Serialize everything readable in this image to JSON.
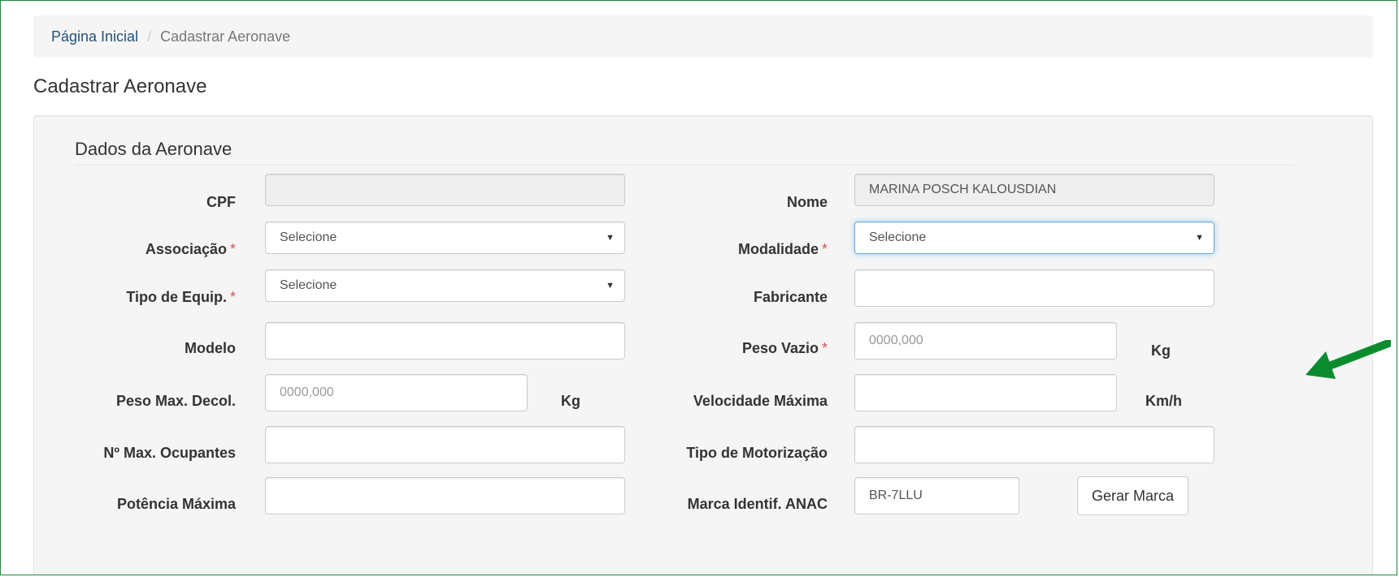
{
  "breadcrumb": {
    "home": "Página Inicial",
    "separator": "/",
    "current": "Cadastrar Aeronave"
  },
  "page_title": "Cadastrar Aeronave",
  "section_title": "Dados da Aeronave",
  "fields": {
    "cpf": {
      "label": "CPF",
      "value": ""
    },
    "nome": {
      "label": "Nome",
      "value": "MARINA POSCH KALOUSDIAN"
    },
    "associacao": {
      "label": "Associação",
      "value": "Selecione",
      "required_mark": "*"
    },
    "modalidade": {
      "label": "Modalidade",
      "value": "Selecione",
      "required_mark": "*"
    },
    "tipo_equip": {
      "label": "Tipo de Equip.",
      "value": "Selecione",
      "required_mark": "*"
    },
    "fabricante": {
      "label": "Fabricante",
      "value": ""
    },
    "modelo": {
      "label": "Modelo",
      "value": ""
    },
    "peso_vazio": {
      "label": "Peso Vazio",
      "placeholder": "0000,000",
      "unit": "Kg",
      "required_mark": "*"
    },
    "peso_max_decol": {
      "label": "Peso Max. Decol.",
      "placeholder": "0000,000",
      "unit": "Kg"
    },
    "velocidade_maxima": {
      "label": "Velocidade Máxima",
      "value": "",
      "unit": "Km/h"
    },
    "max_ocupantes": {
      "label": "Nº Max. Ocupantes",
      "value": ""
    },
    "tipo_motorizacao": {
      "label": "Tipo de Motorização",
      "value": ""
    },
    "potencia_maxima": {
      "label": "Potência Máxima",
      "value": ""
    },
    "marca_anac": {
      "label": "Marca Identif. ANAC",
      "value": "BR-7LLU"
    }
  },
  "buttons": {
    "gerar_marca": "Gerar Marca"
  },
  "icons": {
    "dropdown": "chevron-down-icon",
    "annotation": "arrow-pointer-icon"
  },
  "colors": {
    "frame": "#1c8a3a",
    "arrow": "#0a8c2e",
    "required": "#d9534f",
    "link": "#23527c"
  }
}
